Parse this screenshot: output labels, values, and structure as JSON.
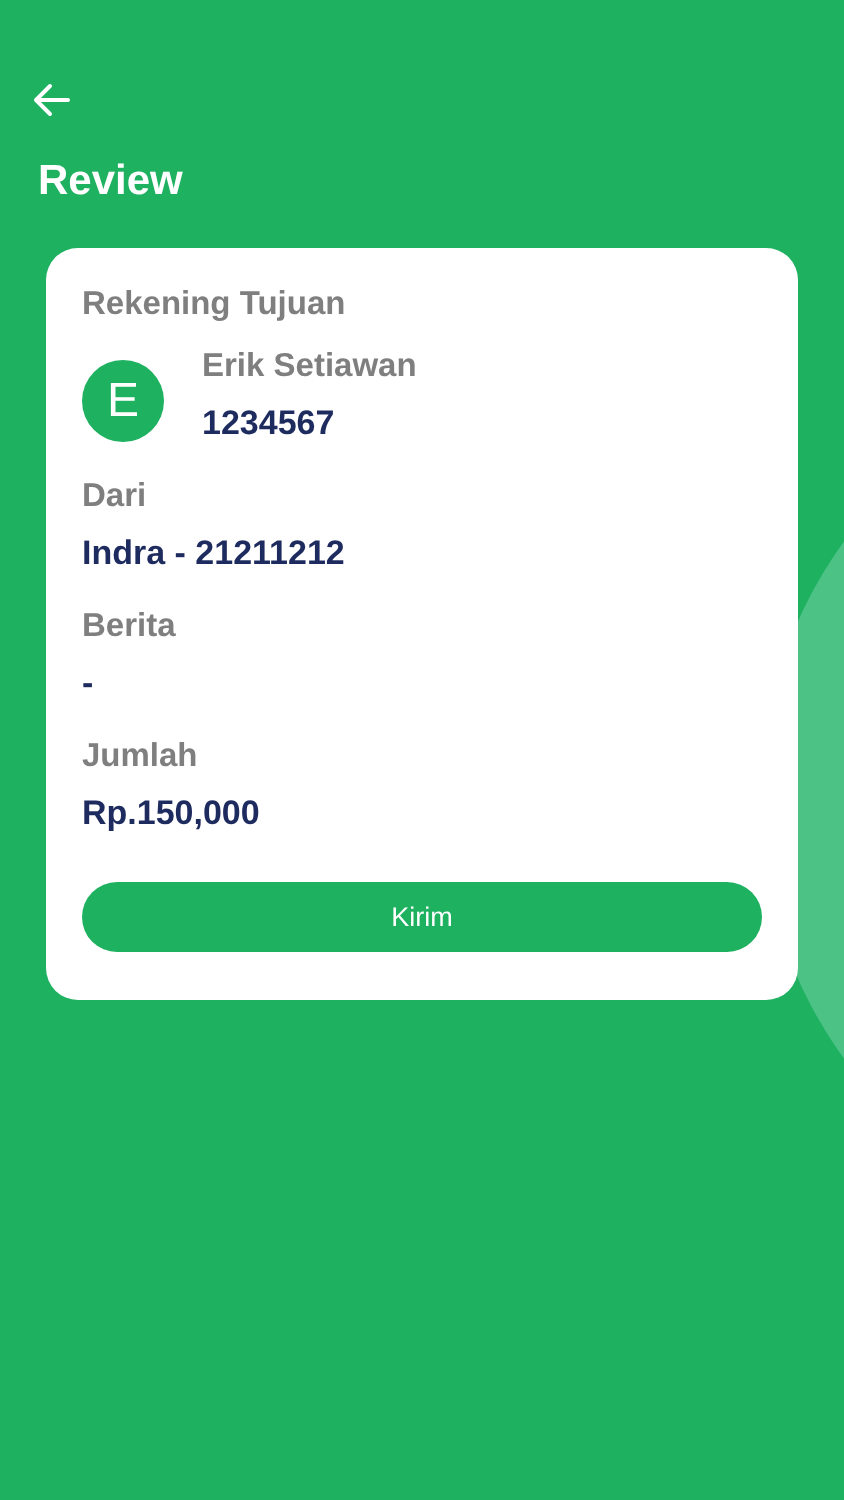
{
  "header": {
    "title": "Review"
  },
  "recipient": {
    "label": "Rekening Tujuan",
    "initial": "E",
    "name": "Erik Setiawan",
    "account": "1234567"
  },
  "fields": [
    {
      "label": "Dari",
      "value": "Indra - 21211212"
    },
    {
      "label": "Berita",
      "value": "-"
    },
    {
      "label": "Jumlah",
      "value": "Rp.150,000"
    }
  ],
  "submit_button": "Kirim"
}
